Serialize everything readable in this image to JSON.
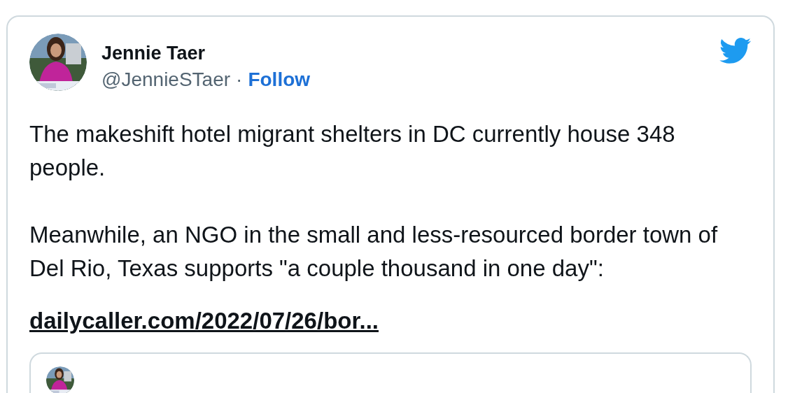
{
  "author": {
    "name": "Jennie Taer",
    "handle": "@JennieSTaer",
    "separator": "·",
    "follow": "Follow"
  },
  "tweet": {
    "paragraphs": [
      "The makeshift hotel migrant shelters in DC currently house 348 people.",
      "Meanwhile, an NGO in the small and less-resourced border town of Del Rio, Texas supports \"a couple thousand in one day\":"
    ],
    "link": "dailycaller.com/2022/07/26/bor..."
  }
}
